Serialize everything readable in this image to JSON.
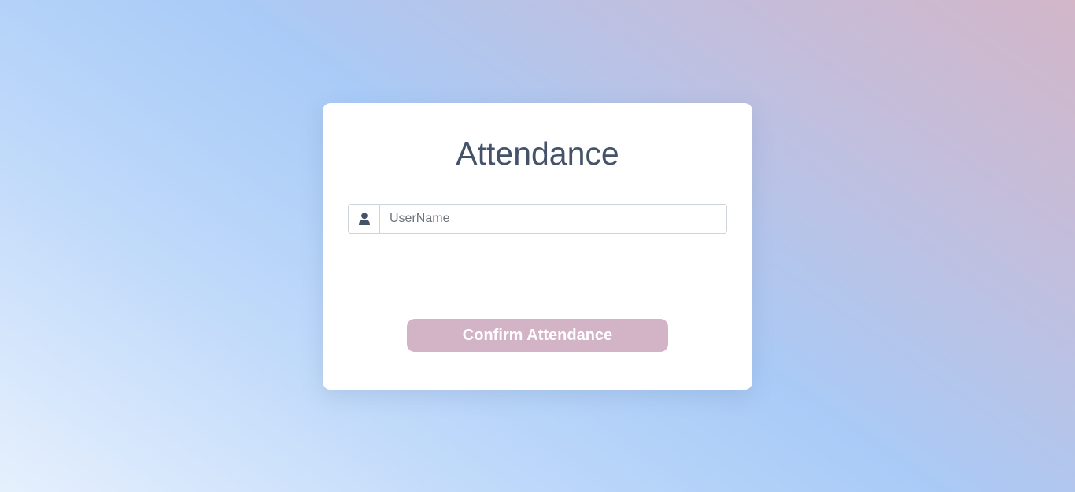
{
  "card": {
    "title": "Attendance"
  },
  "username": {
    "placeholder": "UserName",
    "value": "",
    "icon": "user-icon"
  },
  "confirm_button": {
    "label": "Confirm Attendance"
  },
  "colors": {
    "title_text": "#45536a",
    "icon": "#45536a",
    "button_bg": "#d3b4c6",
    "button_text": "#ffffff",
    "card_bg": "#ffffff",
    "background_start": "#e6f0fd",
    "background_mid": "#a9cbf7",
    "background_end": "#d3b6c8"
  }
}
